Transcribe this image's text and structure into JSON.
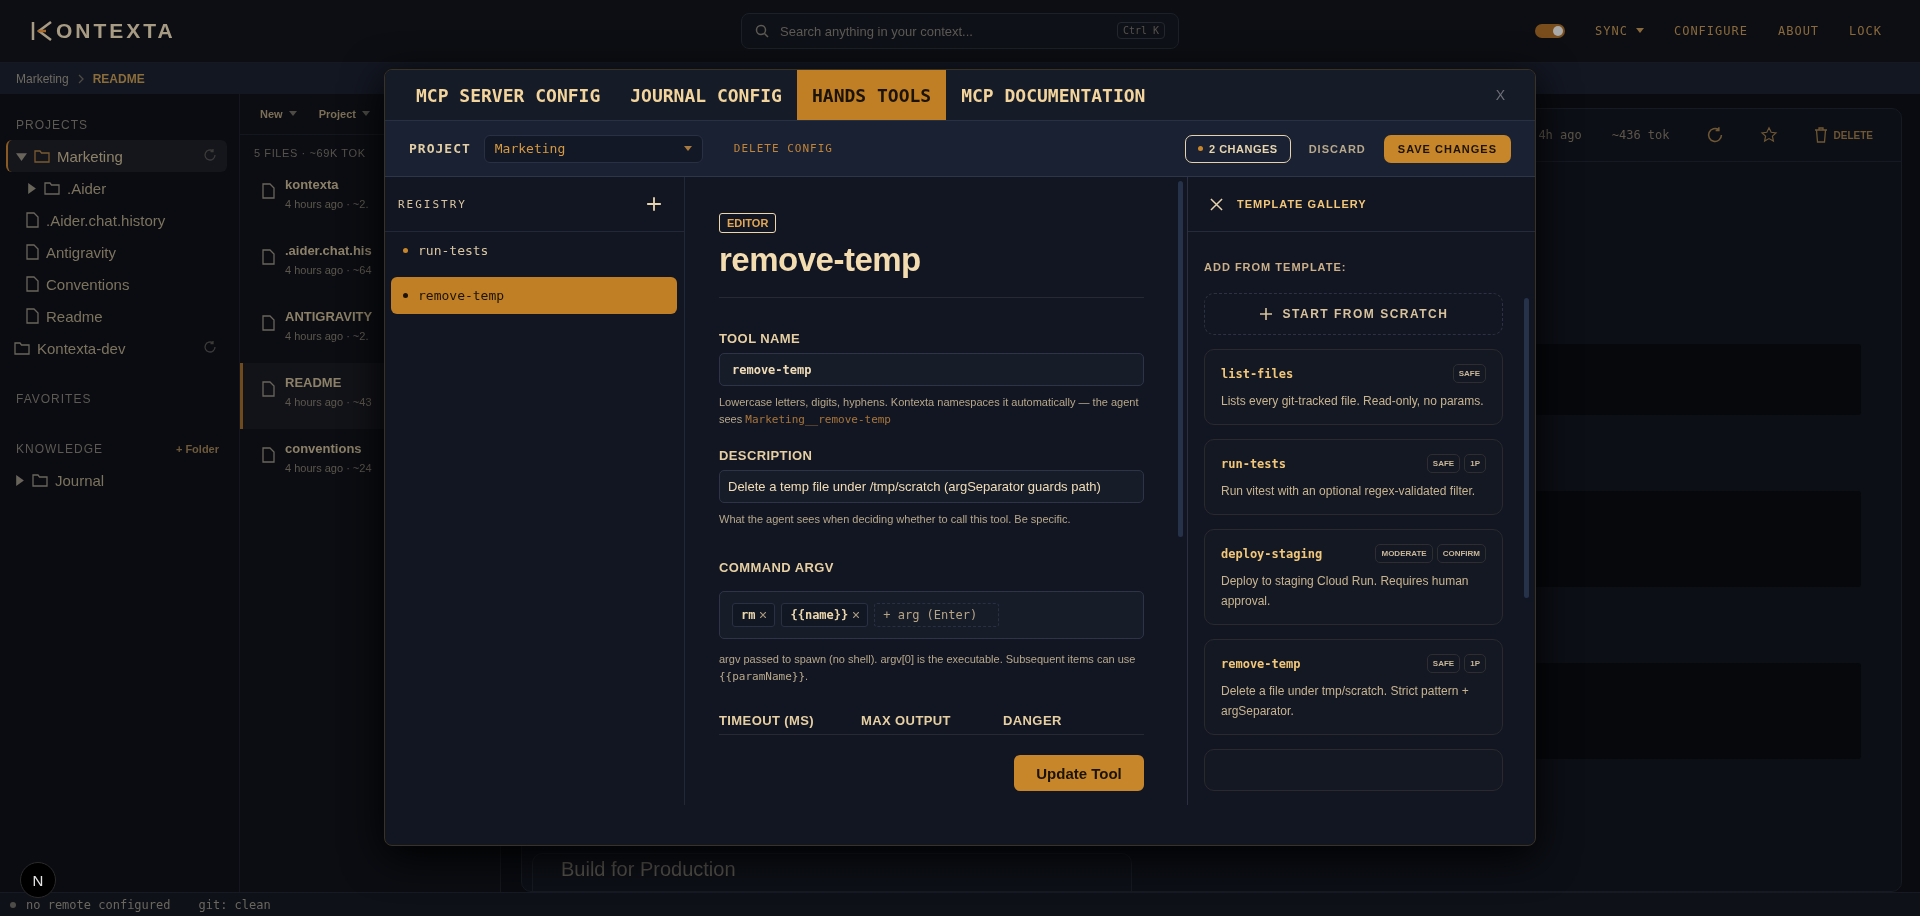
{
  "topbar": {
    "logo_text": "ONTEXTA",
    "search": {
      "placeholder": "Search anything in your context...",
      "shortcut": "Ctrl K"
    },
    "sync_toggle": {
      "on": true
    },
    "menu": [
      {
        "label": "SYNC",
        "kind": "dropdown"
      },
      {
        "label": "CONFIGURE",
        "kind": "link"
      },
      {
        "label": "ABOUT",
        "kind": "link"
      },
      {
        "label": "LOCK",
        "kind": "link"
      }
    ]
  },
  "breadcrumb": [
    {
      "label": "Marketing",
      "current": false
    },
    {
      "label": "README",
      "current": true
    }
  ],
  "sidebar": {
    "sections": [
      {
        "title": "PROJECTS",
        "items": [
          {
            "label": "Marketing",
            "kind": "project",
            "expanded": true,
            "selected": true,
            "children": [
              {
                "label": ".Aider",
                "kind": "folder",
                "expanded": false,
                "selected": false
              },
              {
                "label": ".Aider.chat.history",
                "kind": "file",
                "selected": false
              },
              {
                "label": "Antigravity",
                "kind": "file",
                "selected": false
              },
              {
                "label": "Conventions",
                "kind": "file",
                "selected": false
              },
              {
                "label": "Readme",
                "kind": "file",
                "selected": false
              }
            ]
          },
          {
            "label": "Kontexta-dev",
            "kind": "project",
            "selected": false
          }
        ]
      },
      {
        "title": "FAVORITES"
      },
      {
        "title": "KNOWLEDGE",
        "action": "+ Folder",
        "items": [
          {
            "label": "Journal",
            "kind": "folder",
            "expanded": false,
            "selected": false
          }
        ]
      }
    ]
  },
  "filelist": {
    "menus": [
      {
        "label": "New"
      },
      {
        "label": "Project"
      }
    ],
    "summary": "5 FILES · ~69K TOK",
    "files": [
      {
        "name": "kontexta",
        "meta": "4 hours ago · ~2.",
        "selected": false
      },
      {
        "name": ".aider.chat.his",
        "meta": "4 hours ago · ~64",
        "selected": false
      },
      {
        "name": "ANTIGRAVITY",
        "meta": "4 hours ago · ~2.",
        "selected": false
      },
      {
        "name": "README",
        "meta": "4 hours ago · ~43",
        "selected": true
      },
      {
        "name": "conventions",
        "meta": "4 hours ago · ~24",
        "selected": false
      }
    ]
  },
  "main": {
    "header": {
      "age": "4h ago",
      "tokens": "~436 tok",
      "delete_label": "DELETE"
    },
    "footer_title": "Build for Production"
  },
  "modal": {
    "tabs": [
      {
        "label": "MCP SERVER CONFIG",
        "selected": false
      },
      {
        "label": "JOURNAL CONFIG",
        "selected": false
      },
      {
        "label": "HANDS TOOLS",
        "selected": true
      },
      {
        "label": "MCP DOCUMENTATION",
        "selected": false
      }
    ],
    "close_label": "X",
    "project": {
      "label": "PROJECT",
      "value": "Marketing",
      "delete": "DELETE CONFIG",
      "changes": "2 CHANGES",
      "discard": "DISCARD",
      "save": "SAVE CHANGES"
    },
    "registry": {
      "title": "REGISTRY",
      "items": [
        {
          "name": "run-tests",
          "selected": false
        },
        {
          "name": "remove-temp",
          "selected": true
        }
      ]
    },
    "editor": {
      "badge": "EDITOR",
      "heading": "remove-temp",
      "fields": [
        {
          "kind": "code",
          "label": "TOOL NAME",
          "value": "remove-temp",
          "hint": [
            {
              "kind": "text",
              "text": "Lowercase letters, digits, hyphens. Kontexta namespaces it automatically — the agent sees "
            },
            {
              "kind": "code",
              "text": "Marketing__remove-temp"
            }
          ]
        },
        {
          "kind": "text",
          "label": "DESCRIPTION",
          "value": "Delete a temp file under /tmp/scratch (argSeparator guards path)",
          "hint": [
            {
              "kind": "text",
              "text": "What the agent sees when deciding whether to call this tool. Be specific."
            }
          ]
        },
        {
          "kind": "argv",
          "label": "COMMAND ARGV",
          "chips": [
            "rm",
            "{{name}}"
          ],
          "placeholder": "+ arg (Enter)",
          "hint": [
            {
              "kind": "text",
              "text": "argv passed to spawn (no shell). argv[0] is the executable. Subsequent items can use "
            },
            {
              "kind": "code",
              "text": "{{paramName}}"
            },
            {
              "kind": "text",
              "text": "."
            }
          ]
        }
      ],
      "columns": [
        "TIMEOUT (MS)",
        "MAX OUTPUT",
        "DANGER"
      ],
      "submit": "Update Tool"
    },
    "gallery": {
      "title": "TEMPLATE GALLERY",
      "subtitle": "ADD FROM TEMPLATE:",
      "scratch": "START FROM SCRATCH",
      "templates": [
        {
          "name": "list-files",
          "badges": [
            "SAFE"
          ],
          "description": "Lists every git-tracked file. Read-only, no params."
        },
        {
          "name": "run-tests",
          "badges": [
            "SAFE",
            "1P"
          ],
          "description": "Run vitest with an optional regex-validated filter."
        },
        {
          "name": "deploy-staging",
          "badges": [
            "MODERATE",
            "CONFIRM"
          ],
          "description": "Deploy to staging Cloud Run. Requires human approval."
        },
        {
          "name": "remove-temp",
          "badges": [
            "SAFE",
            "1P"
          ],
          "description": "Delete a file under tmp/scratch. Strict pattern + argSeparator."
        }
      ]
    }
  },
  "dev_badge": "N",
  "status": {
    "remote": "no remote configured",
    "git": "git: clean"
  }
}
